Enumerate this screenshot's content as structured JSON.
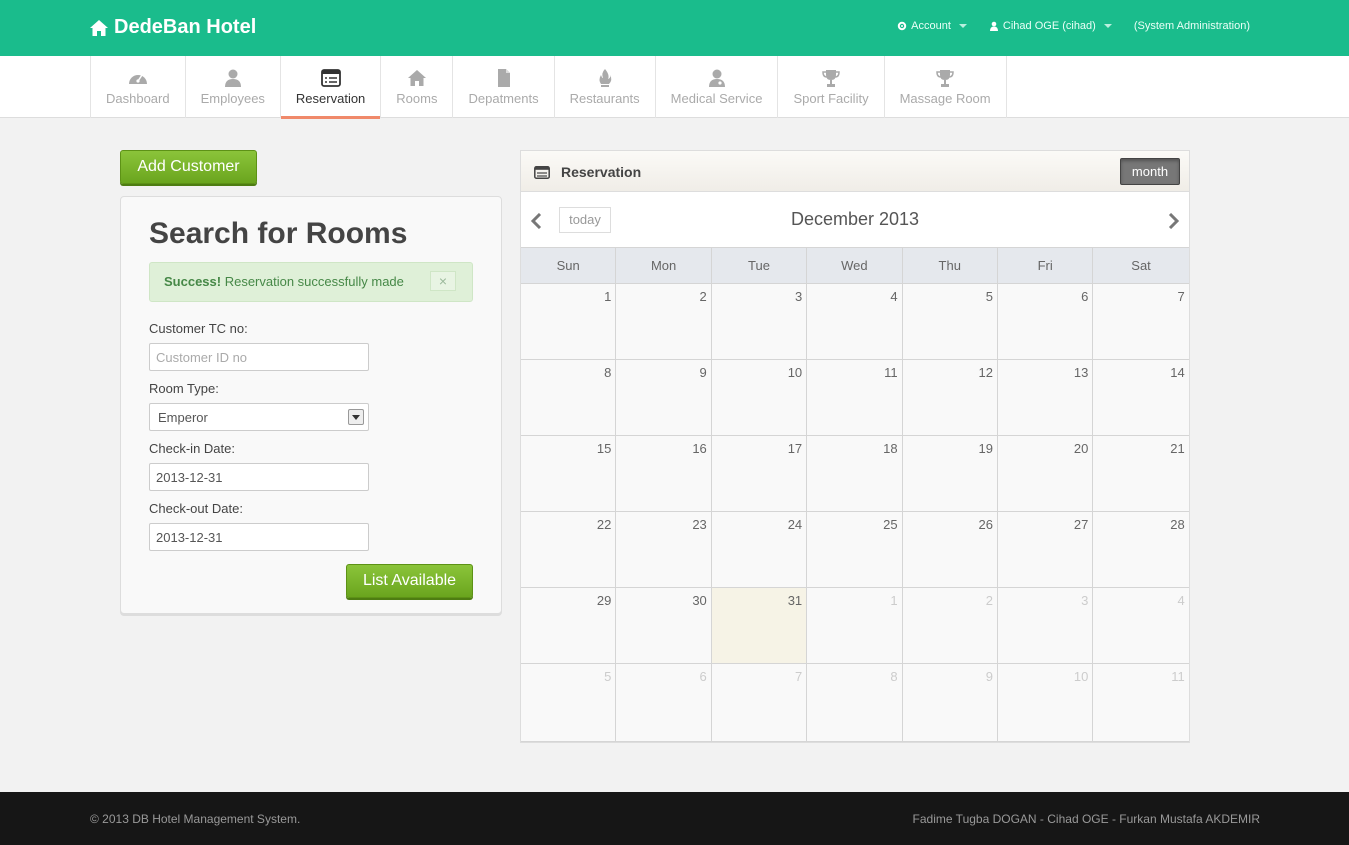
{
  "brand": {
    "title": "DedeBan Hotel",
    "icon": "home-icon"
  },
  "topnav": {
    "account": "Account",
    "user": "Cihad OGE (cihad)",
    "role": "(System Administration)"
  },
  "mainnav": {
    "items": [
      {
        "label": "Dashboard",
        "icon": "dashboard-icon"
      },
      {
        "label": "Employees",
        "icon": "user-icon"
      },
      {
        "label": "Reservation",
        "icon": "list-icon",
        "active": true
      },
      {
        "label": "Rooms",
        "icon": "home-icon"
      },
      {
        "label": "Depatments",
        "icon": "file-icon"
      },
      {
        "label": "Restaurants",
        "icon": "fire-icon"
      },
      {
        "label": "Medical Service",
        "icon": "user-md-icon"
      },
      {
        "label": "Sport Facility",
        "icon": "trophy-icon"
      },
      {
        "label": "Massage Room",
        "icon": "trophy-icon"
      }
    ],
    "active_color": "#f0896a"
  },
  "left": {
    "add_customer": "Add Customer",
    "search_title": "Search for Rooms",
    "alert": {
      "strong": "Success!",
      "text": " Reservation successfully made",
      "close": "×"
    },
    "customer_label": "Customer TC no:",
    "customer_placeholder": "Customer ID no",
    "customer_value": "",
    "room_type_label": "Room Type:",
    "room_type_value": "Emperor",
    "checkin_label": "Check-in Date:",
    "checkin_value": "2013-12-31",
    "checkout_label": "Check-out Date:",
    "checkout_value": "2013-12-31",
    "list_button": "List Available"
  },
  "calendar": {
    "panel_title": "Reservation",
    "month_button": "month",
    "today_button": "today",
    "month_title": "December 2013",
    "dow": [
      "Sun",
      "Mon",
      "Tue",
      "Wed",
      "Thu",
      "Fri",
      "Sat"
    ],
    "weeks": [
      [
        {
          "d": "1"
        },
        {
          "d": "2"
        },
        {
          "d": "3"
        },
        {
          "d": "4"
        },
        {
          "d": "5"
        },
        {
          "d": "6"
        },
        {
          "d": "7"
        }
      ],
      [
        {
          "d": "8"
        },
        {
          "d": "9"
        },
        {
          "d": "10"
        },
        {
          "d": "11"
        },
        {
          "d": "12"
        },
        {
          "d": "13"
        },
        {
          "d": "14"
        }
      ],
      [
        {
          "d": "15"
        },
        {
          "d": "16"
        },
        {
          "d": "17"
        },
        {
          "d": "18"
        },
        {
          "d": "19"
        },
        {
          "d": "20"
        },
        {
          "d": "21"
        }
      ],
      [
        {
          "d": "22"
        },
        {
          "d": "23"
        },
        {
          "d": "24"
        },
        {
          "d": "25"
        },
        {
          "d": "26"
        },
        {
          "d": "27"
        },
        {
          "d": "28"
        }
      ],
      [
        {
          "d": "29"
        },
        {
          "d": "30"
        },
        {
          "d": "31",
          "today": true
        },
        {
          "d": "1",
          "other": true
        },
        {
          "d": "2",
          "other": true
        },
        {
          "d": "3",
          "other": true
        },
        {
          "d": "4",
          "other": true
        }
      ],
      [
        {
          "d": "5",
          "other": true
        },
        {
          "d": "6",
          "other": true
        },
        {
          "d": "7",
          "other": true
        },
        {
          "d": "8",
          "other": true
        },
        {
          "d": "9",
          "other": true
        },
        {
          "d": "10",
          "other": true
        },
        {
          "d": "11",
          "other": true
        }
      ]
    ]
  },
  "footer": {
    "left": "© 2013 DB Hotel Management System.",
    "right": "Fadime Tugba DOGAN - Cihad OGE - Furkan Mustafa AKDEMIR"
  },
  "colors": {
    "topbar": "#1abc8c",
    "green_button": "#7ab52a",
    "footer": "#161616"
  }
}
